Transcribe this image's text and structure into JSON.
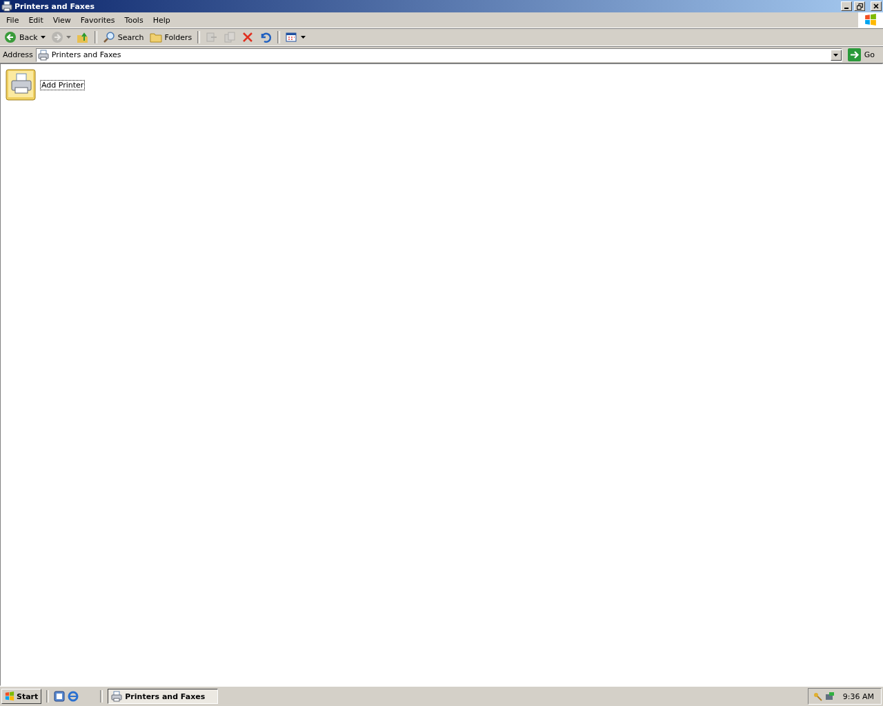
{
  "window": {
    "title": "Printers and Faxes"
  },
  "menu": [
    "File",
    "Edit",
    "View",
    "Favorites",
    "Tools",
    "Help"
  ],
  "toolbar": [
    {
      "kind": "back",
      "label": "Back",
      "dropdown": true,
      "disabled": false
    },
    {
      "kind": "forward",
      "dropdown": true,
      "disabled": true
    },
    {
      "kind": "up",
      "disabled": false
    },
    {
      "kind": "separator"
    },
    {
      "kind": "search",
      "label": "Search",
      "disabled": false
    },
    {
      "kind": "folders",
      "label": "Folders",
      "disabled": false
    },
    {
      "kind": "separator"
    },
    {
      "kind": "move",
      "disabled": true
    },
    {
      "kind": "copy",
      "disabled": true
    },
    {
      "kind": "delete",
      "disabled": false
    },
    {
      "kind": "undo",
      "disabled": false
    },
    {
      "kind": "separator"
    },
    {
      "kind": "views",
      "dropdown": true,
      "disabled": false
    }
  ],
  "address": {
    "label": "Address",
    "value": "Printers and Faxes",
    "go": "Go"
  },
  "items": [
    {
      "label": "Add Printer",
      "selected": true
    }
  ],
  "taskbar": {
    "start": "Start",
    "tasks": [
      {
        "label": "Printers and Faxes",
        "selected": true
      }
    ],
    "clock": "9:36 AM"
  }
}
